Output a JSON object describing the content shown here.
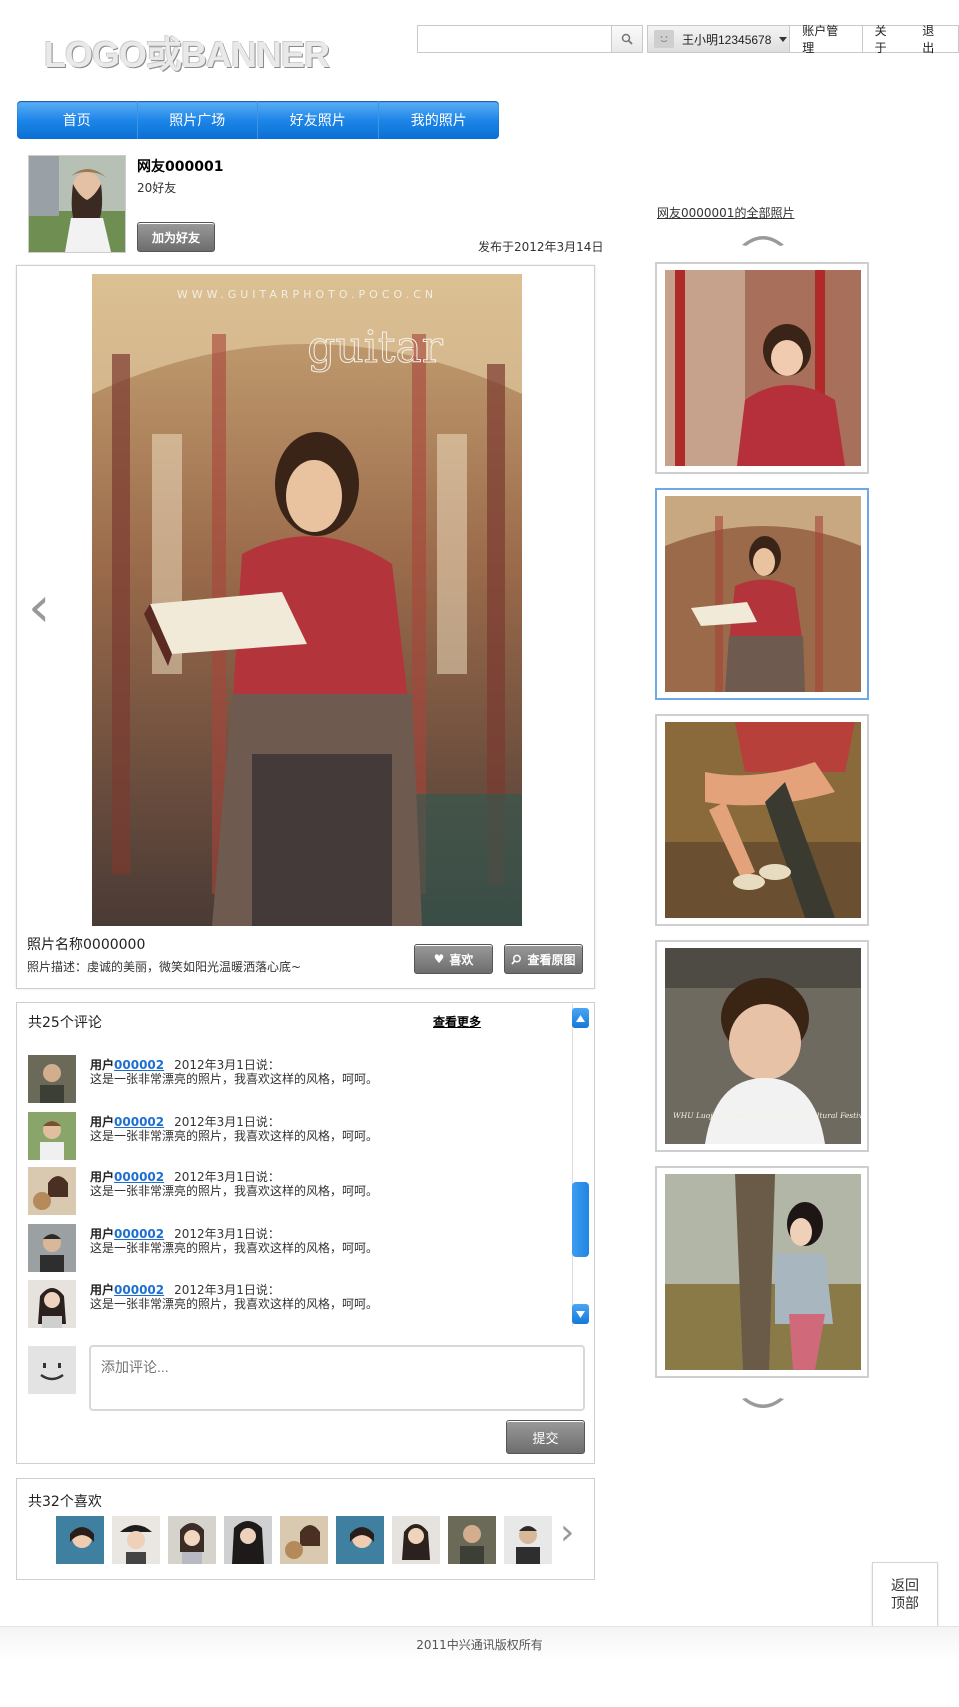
{
  "header": {
    "logo_text": "LOGO或BANNER",
    "search_placeholder": "",
    "username": "王小明12345678",
    "account_label": "账户管理",
    "about_label": "关于",
    "logout_label": "退出"
  },
  "nav": {
    "items": [
      "首页",
      "照片广场",
      "好友照片",
      "我的照片"
    ]
  },
  "profile": {
    "name": "网友000001",
    "friends": "20好友",
    "add_friend": "加为好友",
    "published": "发布于2012年3月14日"
  },
  "photo": {
    "title": "照片名称0000000",
    "description": "照片描述：虔诚的美丽，微笑如阳光温暖洒落心底~",
    "watermark": "WWW.GUITARPHOTO.POCO.CN",
    "watermark_script": "guitar",
    "like_label": "喜欢",
    "view_original_label": "查看原图"
  },
  "comments": {
    "count_label": "共25个评论",
    "see_more": "查看更多",
    "items": [
      {
        "prefix": "用户",
        "user": "000002",
        "date": "2012年3月1日说：",
        "text": "这是一张非常漂亮的照片，我喜欢这样的风格，呵呵。"
      },
      {
        "prefix": "用户",
        "user": "000002",
        "date": "2012年3月1日说：",
        "text": "这是一张非常漂亮的照片，我喜欢这样的风格，呵呵。"
      },
      {
        "prefix": "用户",
        "user": "000002",
        "date": "2012年3月1日说：",
        "text": "这是一张非常漂亮的照片，我喜欢这样的风格，呵呵。"
      },
      {
        "prefix": "用户",
        "user": "000002",
        "date": "2012年3月1日说：",
        "text": "这是一张非常漂亮的照片，我喜欢这样的风格，呵呵。"
      },
      {
        "prefix": "用户",
        "user": "000002",
        "date": "2012年3月1日说：",
        "text": "这是一张非常漂亮的照片，我喜欢这样的风格，呵呵。"
      }
    ],
    "input_placeholder": "添加评论...",
    "submit_label": "提交"
  },
  "likes": {
    "count_label": "共32个喜欢"
  },
  "sidebar": {
    "all_photos_link": "网友0000001的全部照片",
    "thumb_caption_4": "WHU Luojia Autumn International Cultural Festival"
  },
  "back_to_top": {
    "line1": "返回",
    "line2": "顶部"
  },
  "footer": {
    "copyright": "2011中兴通讯版权所有"
  },
  "colors": {
    "nav_blue": "#1e86e8",
    "link_blue": "#1d6fd0",
    "scroll_blue": "#1f86e4",
    "button_grey": "#7a7a7a"
  }
}
